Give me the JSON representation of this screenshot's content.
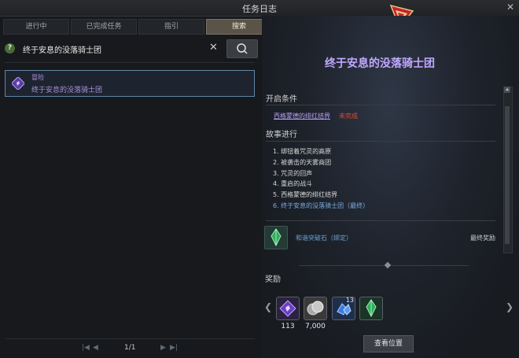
{
  "window": {
    "title": "任务日志",
    "close_symbol": "✕"
  },
  "tabs": [
    {
      "label": "进行中",
      "active": false
    },
    {
      "label": "已完成任务",
      "active": false
    },
    {
      "label": "指引",
      "active": false
    },
    {
      "label": "搜索",
      "active": true
    }
  ],
  "search": {
    "help_symbol": "?",
    "value": "终于安息的没落骑士团",
    "clear_symbol": "✕",
    "button_icon": "search-icon"
  },
  "results": [
    {
      "category": "冒险",
      "name": "终于安息的没落骑士团",
      "icon": "adventure-quest-icon"
    }
  ],
  "pager": {
    "first": "|◀",
    "prev": "◀",
    "page": "1/1",
    "next": "▶",
    "last": "▶|"
  },
  "detail": {
    "title": "终于安息的没落骑士团",
    "start_condition_label": "开启条件",
    "condition": {
      "text": "西格蒙德的绯红结界",
      "status": "未完成"
    },
    "story_label": "故事进行",
    "story_items": [
      {
        "text": "1. 绑钮着咒灵的高原",
        "current": false
      },
      {
        "text": "2. 被袭击的天雾商团",
        "current": false
      },
      {
        "text": "3. 咒灵的回声",
        "current": false
      },
      {
        "text": "4. 重启的战斗",
        "current": false
      },
      {
        "text": "5. 西格蒙德的绯红结界",
        "current": false
      },
      {
        "text": "6. 终于安息的没落骑士团（最终）",
        "current": true
      }
    ],
    "final_reward": {
      "name": "和谐突破石（绑定）",
      "label": "最终奖励",
      "icon": "green-crystal-icon"
    },
    "rewards_label": "奖励",
    "rewards": [
      {
        "icon": "purple-gem-icon",
        "quantity": "113",
        "count": ""
      },
      {
        "icon": "silver-coin-icon",
        "quantity": "7,000",
        "count": ""
      },
      {
        "icon": "blue-crystal-icon",
        "quantity": "",
        "count": "13"
      },
      {
        "icon": "green-crystal-icon",
        "quantity": "",
        "count": ""
      }
    ],
    "view_location_label": "查看位置"
  },
  "colors": {
    "accent_purple": "#c0a8ff",
    "link_purple": "#b59cf2",
    "status_red": "#e04a3a",
    "current_blue": "#7aaee6",
    "selection_border": "#5f87a5"
  }
}
